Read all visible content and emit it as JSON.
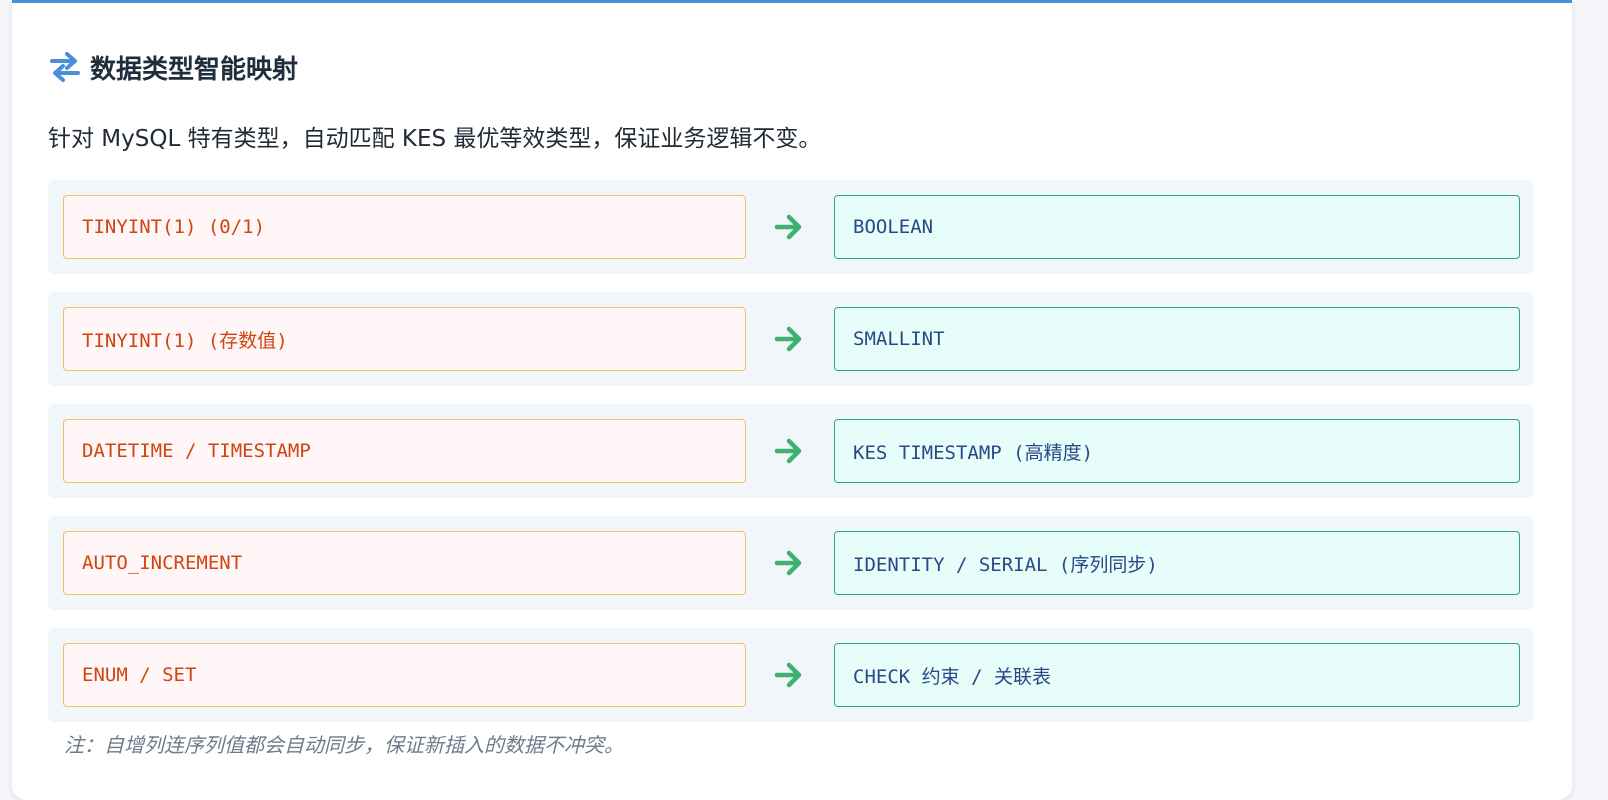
{
  "header": {
    "icon": "swap-arrows-icon",
    "title": "数据类型智能映射"
  },
  "description": "针对 MySQL 特有类型，自动匹配 KES 最优等效类型，保证业务逻辑不变。",
  "mappings": [
    {
      "source": "TINYINT(1) (0/1)",
      "target": "BOOLEAN"
    },
    {
      "source": "TINYINT(1) (存数值)",
      "target": "SMALLINT"
    },
    {
      "source": "DATETIME / TIMESTAMP",
      "target": "KES TIMESTAMP (高精度)"
    },
    {
      "source": "AUTO_INCREMENT",
      "target": "IDENTITY / SERIAL (序列同步)"
    },
    {
      "source": "ENUM / SET",
      "target": "CHECK 约束 / 关联表"
    }
  ],
  "note": "注：自增列连序列值都会自动同步，保证新插入的数据不冲突。",
  "colors": {
    "accent": "#4a90d9",
    "arrow": "#3cb371",
    "source_text": "#d2440f",
    "source_border": "#f1c25e",
    "target_text": "#274a87",
    "target_border": "#2ba58b"
  }
}
